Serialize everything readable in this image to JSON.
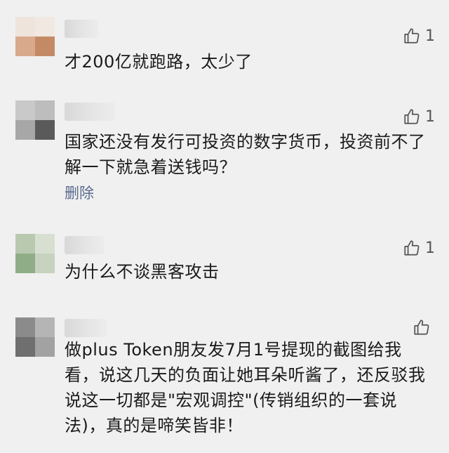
{
  "comments": [
    {
      "text": "才200亿就跑路，太少了",
      "likes": "1",
      "delete_label": ""
    },
    {
      "text": "国家还没有发行可投资的数字货币，投资前不了解一下就急着送钱吗？",
      "likes": "1",
      "delete_label": "删除"
    },
    {
      "text": "为什么不谈黑客攻击",
      "likes": "1",
      "delete_label": ""
    },
    {
      "text": "做plus Token朋友发7月1号提现的截图给我看，说这几天的负面让她耳朵听酱了，还反驳我说这一切都是\"宏观调控\"(传销组织的一套说法)，真的是啼笑皆非！",
      "likes": "",
      "delete_label": ""
    }
  ],
  "icons": {
    "like": "thumbs-up-icon"
  },
  "colors": {
    "background": "#f0f0f0",
    "text": "#1a1a1a",
    "link": "#5b6a8f",
    "icon": "#555555"
  }
}
